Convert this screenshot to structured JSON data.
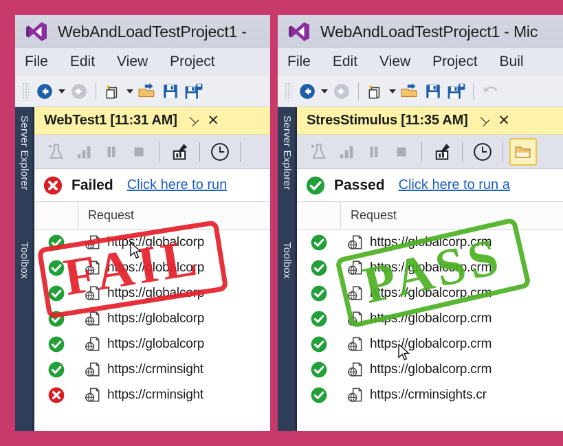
{
  "theme": {
    "page_border": "#c73a6b",
    "titlebar_bg": "#d4d7e2",
    "tab_active_bg": "#fdf3a8",
    "sidebar_bg": "#2f3e58",
    "fail_color": "#e6202a",
    "pass_color": "#4bb122",
    "link_color": "#1f5fbf"
  },
  "left_window": {
    "titlebar": {
      "logo_icon": "visual-studio-logo-icon",
      "title": "WebAndLoadTestProject1 -"
    },
    "menu": [
      "File",
      "Edit",
      "View",
      "Project"
    ],
    "toolbar_icons": [
      "navigate-back-icon",
      "navigate-back-dropdown-caret",
      "navigate-forward-icon",
      "separator",
      "new-project-icon",
      "new-project-dropdown-caret",
      "open-file-icon",
      "save-icon",
      "save-all-icon"
    ],
    "vertical_tabs": [
      "Server Explorer",
      "Toolbox"
    ],
    "document_tab": {
      "title": "WebTest1 [11:31 AM]",
      "pin_icon": "pin-icon",
      "close_icon": "close-icon"
    },
    "test_toolbar_icons": [
      "run-test-flask-icon",
      "results-chart-icon",
      "pause-icon",
      "stop-icon",
      "separator",
      "edit-run-settings-icon",
      "separator",
      "history-clock-icon",
      "separator"
    ],
    "status": {
      "icon": "error-circle-icon",
      "label": "Failed",
      "link": "Click here to run"
    },
    "grid": {
      "columns": [
        "",
        "Request"
      ],
      "rows": [
        {
          "status": "pass",
          "icon": "web-request-icon",
          "url": "https://globalcorp"
        },
        {
          "status": "pass",
          "icon": "web-request-icon",
          "url": "https://globalcorp"
        },
        {
          "status": "pass",
          "icon": "web-request-icon",
          "url": "https://globalcorp"
        },
        {
          "status": "pass",
          "icon": "web-request-icon",
          "url": "https://globalcorp"
        },
        {
          "status": "pass",
          "icon": "web-request-icon",
          "url": "https://globalcorp"
        },
        {
          "status": "pass",
          "icon": "web-request-icon",
          "url": "https://crminsight"
        },
        {
          "status": "fail",
          "icon": "web-request-icon",
          "url": "https://crminsight"
        }
      ]
    },
    "stamp": "FAIL"
  },
  "right_window": {
    "titlebar": {
      "logo_icon": "visual-studio-logo-icon",
      "title": "WebAndLoadTestProject1 - Mic"
    },
    "menu": [
      "File",
      "Edit",
      "View",
      "Project",
      "Buil"
    ],
    "toolbar_icons": [
      "navigate-back-icon",
      "navigate-back-dropdown-caret",
      "navigate-forward-icon",
      "separator",
      "new-project-icon",
      "new-project-dropdown-caret",
      "open-file-icon",
      "save-icon",
      "save-all-icon",
      "separator",
      "undo-icon"
    ],
    "vertical_tabs": [
      "Server Explorer",
      "Toolbox"
    ],
    "document_tab": {
      "title": "StresStimulus [11:35 AM]",
      "pin_icon": "pin-icon",
      "close_icon": "close-icon"
    },
    "test_toolbar_icons": [
      "run-test-flask-icon",
      "results-chart-icon",
      "pause-icon",
      "stop-icon",
      "separator",
      "edit-run-settings-icon",
      "separator",
      "history-clock-icon",
      "separator",
      "open-folder-icon"
    ],
    "status": {
      "icon": "success-circle-icon",
      "label": "Passed",
      "link": "Click here to run a"
    },
    "grid": {
      "columns": [
        "",
        "Request"
      ],
      "rows": [
        {
          "status": "pass",
          "icon": "web-request-icon",
          "url": "https://globalcorp.crm"
        },
        {
          "status": "pass",
          "icon": "web-request-icon",
          "url": "https://globalcorp.crm"
        },
        {
          "status": "pass",
          "icon": "web-request-icon",
          "url": "https://globalcorp.crm"
        },
        {
          "status": "pass",
          "icon": "web-request-icon",
          "url": "https://globalcorp.crm"
        },
        {
          "status": "pass",
          "icon": "web-request-icon",
          "url": "https://globalcorp.crm"
        },
        {
          "status": "pass",
          "icon": "web-request-icon",
          "url": "https://globalcorp.crm"
        },
        {
          "status": "pass",
          "icon": "web-request-icon",
          "url": "https://crminsights.cr"
        }
      ]
    },
    "stamp": "PASS"
  }
}
